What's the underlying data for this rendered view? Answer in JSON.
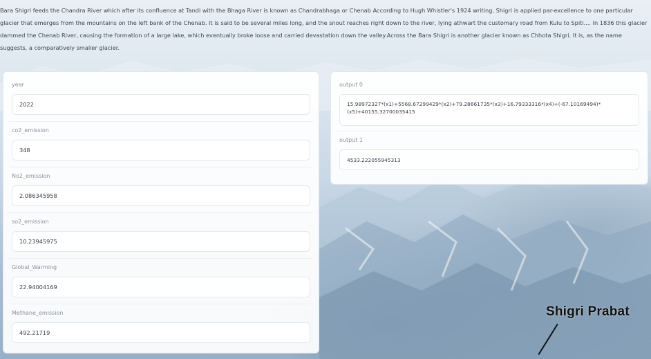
{
  "description": "Bara Shigri feeds the Chandra River which after its confluence at Tandi with the Bhaga River is known as Chandrabhaga or Chenab According to Hugh Whistler's 1924 writing, Shigri is applied par-excellence to one particular glacier that emerges from the mountains on the left bank of the Chenab. It is said to be several miles long, and the snout reaches right down to the river, lying athwart the customary road from Kulu to Spiti.... In 1836 this glacier dammed the Chenab River, causing the formation of a large lake, which eventually broke loose and carried devastation down the valley.Across the Bara Shigri is another glacier known as Chhota Shigri. It is, as the name suggests, a comparatively smaller glacier.",
  "inputs": [
    {
      "label": "year",
      "value": "2022"
    },
    {
      "label": "co2_emission",
      "value": "348"
    },
    {
      "label": "No2_emission",
      "value": "2.086345958"
    },
    {
      "label": "so2_emission",
      "value": "10.23945975"
    },
    {
      "label": "Global_Warming",
      "value": "22.94004169"
    },
    {
      "label": "Methane_emission",
      "value": "492.21719"
    }
  ],
  "outputs": [
    {
      "label": "output 0",
      "value": "15.98972327*(x1)+5568.67299429*(x2)+79.28661735*(x3)+16.79333316*(x4)+(-67.10169494)*(x5)+40155.32700035415"
    },
    {
      "label": "output 1",
      "value": "4533.222055945313"
    }
  ],
  "image_caption": "Shigri Prabat"
}
